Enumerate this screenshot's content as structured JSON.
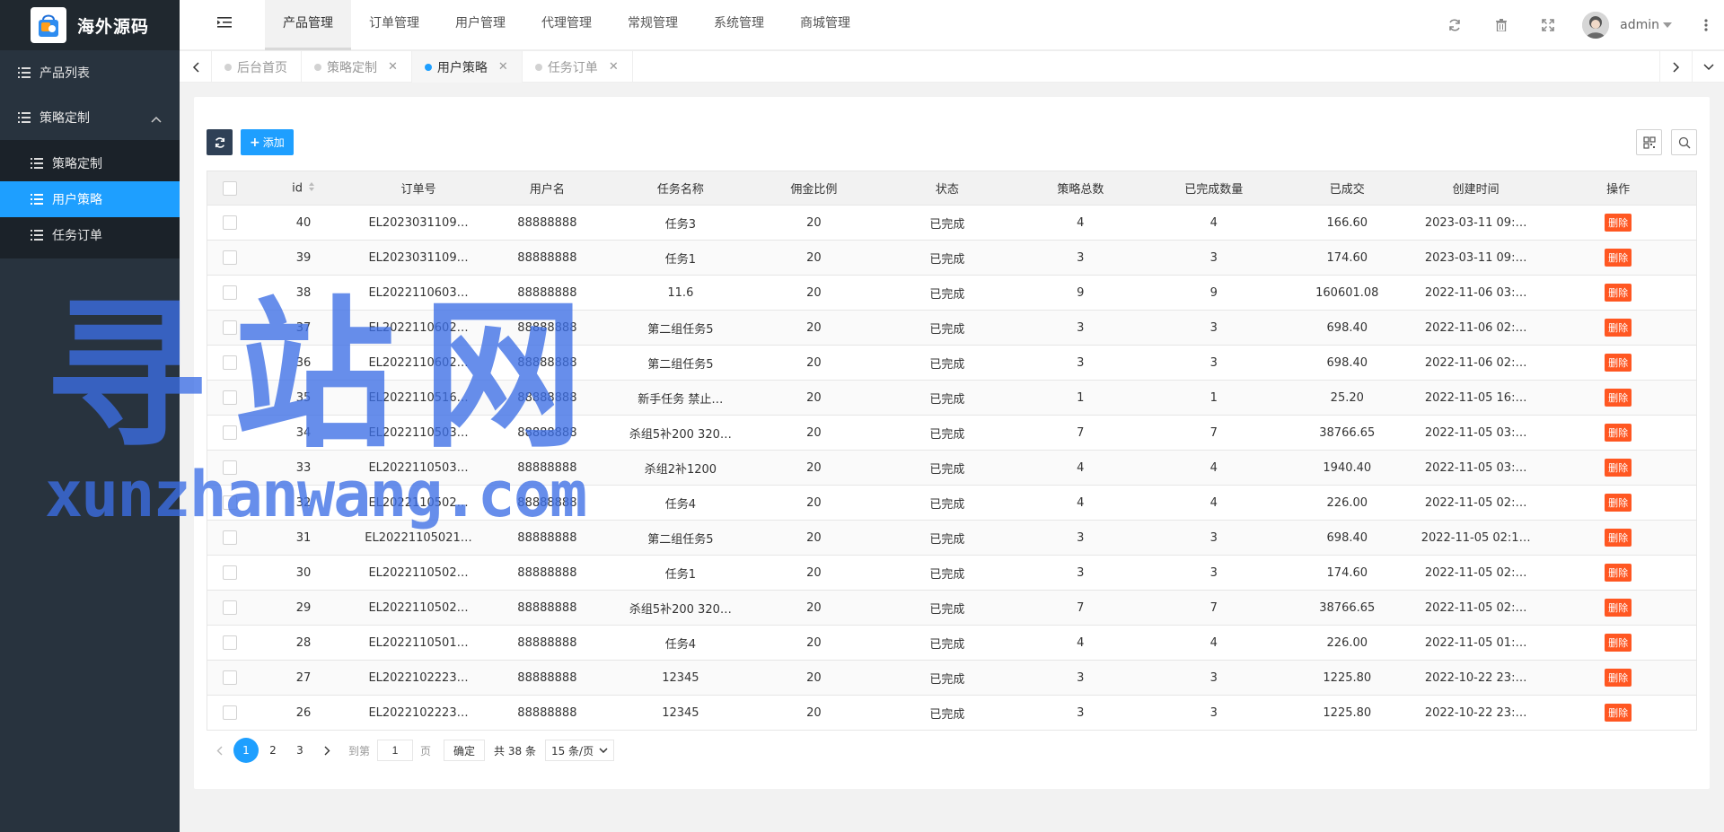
{
  "brand": {
    "name": "海外源码"
  },
  "sidebar": {
    "items": [
      {
        "label": "产品列表"
      },
      {
        "label": "策略定制",
        "expanded": true
      }
    ],
    "sub_items": [
      {
        "label": "策略定制",
        "active": false
      },
      {
        "label": "用户策略",
        "active": true
      },
      {
        "label": "任务订单",
        "active": false
      }
    ]
  },
  "header": {
    "nav": [
      "产品管理",
      "订单管理",
      "用户管理",
      "代理管理",
      "常规管理",
      "系统管理",
      "商城管理"
    ],
    "active_nav": "产品管理",
    "user": "admin",
    "icons": [
      "refresh-icon",
      "trash-icon",
      "fullscreen-icon",
      "more-icon"
    ]
  },
  "tabs": [
    {
      "label": "后台首页",
      "closable": false,
      "active": false
    },
    {
      "label": "策略定制",
      "closable": true,
      "active": false
    },
    {
      "label": "用户策略",
      "closable": true,
      "active": true
    },
    {
      "label": "任务订单",
      "closable": true,
      "active": false
    }
  ],
  "toolbar": {
    "add_label": "添加"
  },
  "table": {
    "columns": [
      "id",
      "订单号",
      "用户名",
      "任务名称",
      "佣金比例",
      "状态",
      "策略总数",
      "已完成数量",
      "已成交",
      "创建时间",
      "操作"
    ],
    "rows": [
      [
        "40",
        "EL2023031109…",
        "88888888",
        "任务3",
        "20",
        "已完成",
        "4",
        "4",
        "166.60",
        "2023-03-11 09:…"
      ],
      [
        "39",
        "EL2023031109…",
        "88888888",
        "任务1",
        "20",
        "已完成",
        "3",
        "3",
        "174.60",
        "2023-03-11 09:…"
      ],
      [
        "38",
        "EL2022110603…",
        "88888888",
        "11.6",
        "20",
        "已完成",
        "9",
        "9",
        "160601.08",
        "2022-11-06 03:…"
      ],
      [
        "37",
        "EL2022110602…",
        "88888888",
        "第二组任务5",
        "20",
        "已完成",
        "3",
        "3",
        "698.40",
        "2022-11-06 02:…"
      ],
      [
        "36",
        "EL2022110602…",
        "88888888",
        "第二组任务5",
        "20",
        "已完成",
        "3",
        "3",
        "698.40",
        "2022-11-06 02:…"
      ],
      [
        "35",
        "EL2022110516…",
        "88888888",
        "新手任务 禁止…",
        "20",
        "已完成",
        "1",
        "1",
        "25.20",
        "2022-11-05 16:…"
      ],
      [
        "34",
        "EL2022110503…",
        "88888888",
        "杀组5补200 320…",
        "20",
        "已完成",
        "7",
        "7",
        "38766.65",
        "2022-11-05 03:…"
      ],
      [
        "33",
        "EL2022110503…",
        "88888888",
        "杀组2补1200",
        "20",
        "已完成",
        "4",
        "4",
        "1940.40",
        "2022-11-05 03:…"
      ],
      [
        "32",
        "EL2022110502…",
        "88888888",
        "任务4",
        "20",
        "已完成",
        "4",
        "4",
        "226.00",
        "2022-11-05 02:…"
      ],
      [
        "31",
        "EL20221105021…",
        "88888888",
        "第二组任务5",
        "20",
        "已完成",
        "3",
        "3",
        "698.40",
        "2022-11-05 02:1…"
      ],
      [
        "30",
        "EL2022110502…",
        "88888888",
        "任务1",
        "20",
        "已完成",
        "3",
        "3",
        "174.60",
        "2022-11-05 02:…"
      ],
      [
        "29",
        "EL2022110502…",
        "88888888",
        "杀组5补200 320…",
        "20",
        "已完成",
        "7",
        "7",
        "38766.65",
        "2022-11-05 02:…"
      ],
      [
        "28",
        "EL2022110501…",
        "88888888",
        "任务4",
        "20",
        "已完成",
        "4",
        "4",
        "226.00",
        "2022-11-05 01:…"
      ],
      [
        "27",
        "EL2022102223…",
        "88888888",
        "12345",
        "20",
        "已完成",
        "3",
        "3",
        "1225.80",
        "2022-10-22 23:…"
      ],
      [
        "26",
        "EL2022102223…",
        "88888888",
        "12345",
        "20",
        "已完成",
        "3",
        "3",
        "1225.80",
        "2022-10-22 23:…"
      ]
    ],
    "delete_label": "删除"
  },
  "pagination": {
    "pages": [
      "1",
      "2",
      "3"
    ],
    "current": "1",
    "goto_label": "到第",
    "goto_value": "1",
    "page_suffix": "页",
    "confirm_label": "确定",
    "total_label": "共 38 条",
    "page_size_label": "15 条/页"
  },
  "watermark": {
    "big": "寻站网",
    "small": "xunzhanwang.com"
  }
}
